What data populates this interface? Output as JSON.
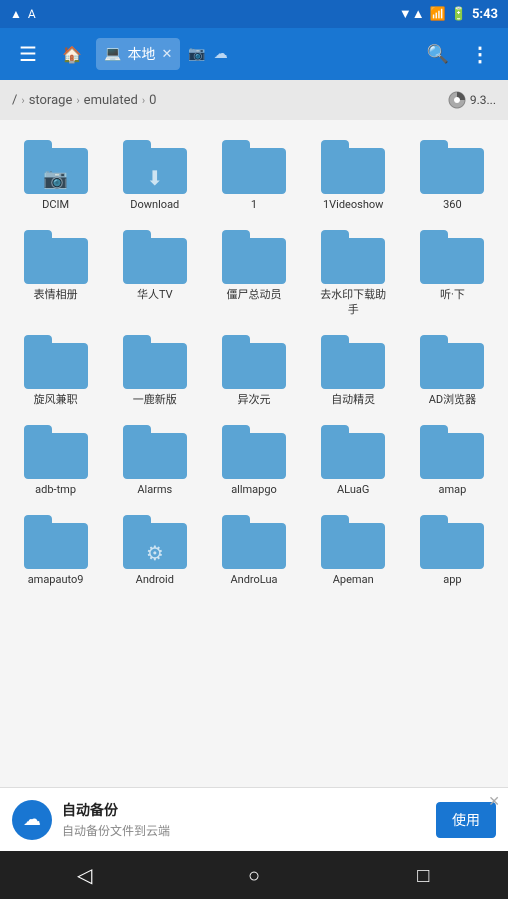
{
  "statusBar": {
    "time": "5:43",
    "signal": "▲",
    "wifi": "▼",
    "battery": "🔋"
  },
  "appBar": {
    "menuIcon": "☰",
    "homeIcon": "🏠",
    "tabLabel": "本地",
    "tabIcon": "💻",
    "closeIcon": "✕",
    "extraIcon": "📷",
    "cloudIcon": "☁",
    "searchIcon": "🔍",
    "moreIcon": "⋮"
  },
  "breadcrumb": {
    "separator": "/",
    "chevron1": "›",
    "path1": "storage",
    "chevron2": "›",
    "path2": "emulated",
    "chevron3": "›",
    "currentDir": "0",
    "storageInfo": "9.3..."
  },
  "folders": [
    {
      "name": "DCIM",
      "overlayIcon": "📷"
    },
    {
      "name": "Download",
      "overlayIcon": "⬇"
    },
    {
      "name": "1",
      "overlayIcon": ""
    },
    {
      "name": "1Videoshow",
      "overlayIcon": ""
    },
    {
      "name": "360",
      "overlayIcon": ""
    },
    {
      "name": "表情相册",
      "overlayIcon": ""
    },
    {
      "name": "华人TV",
      "overlayIcon": ""
    },
    {
      "name": "僵尸总动员",
      "overlayIcon": ""
    },
    {
      "name": "去水印下载助手",
      "overlayIcon": ""
    },
    {
      "name": "听·下",
      "overlayIcon": ""
    },
    {
      "name": "旋风兼职",
      "overlayIcon": ""
    },
    {
      "name": "一鹿新版",
      "overlayIcon": ""
    },
    {
      "name": "异次元",
      "overlayIcon": ""
    },
    {
      "name": "自动精灵",
      "overlayIcon": ""
    },
    {
      "name": "AD浏览器",
      "overlayIcon": ""
    },
    {
      "name": "adb-tmp",
      "overlayIcon": ""
    },
    {
      "name": "Alarms",
      "overlayIcon": ""
    },
    {
      "name": "allmapgo",
      "overlayIcon": ""
    },
    {
      "name": "ALuaG",
      "overlayIcon": ""
    },
    {
      "name": "amap",
      "overlayIcon": ""
    },
    {
      "name": "amapauto9",
      "overlayIcon": ""
    },
    {
      "name": "Android",
      "overlayIcon": "⚙"
    },
    {
      "name": "AndroLua",
      "overlayIcon": ""
    },
    {
      "name": "Apeman",
      "overlayIcon": ""
    },
    {
      "name": "app",
      "overlayIcon": ""
    }
  ],
  "banner": {
    "title": "自动备份",
    "subtitle": "自动备份文件到云端",
    "actionLabel": "使用",
    "closeIcon": "✕"
  },
  "navBar": {
    "backIcon": "◁",
    "homeIcon": "○",
    "recentIcon": "□"
  }
}
